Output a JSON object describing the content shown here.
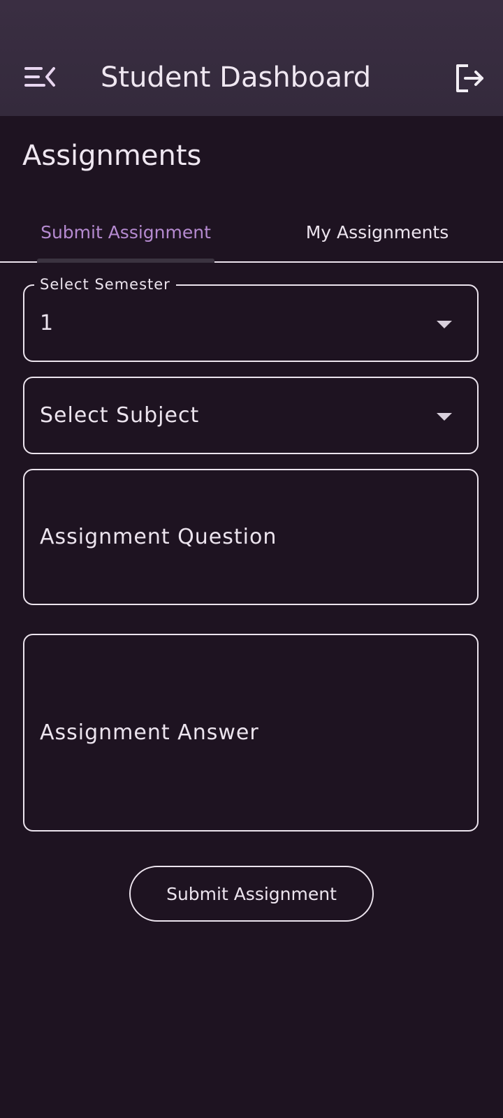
{
  "app_bar": {
    "menu_icon": "menu-open-icon",
    "title": "Student Dashboard",
    "logout_icon": "logout-icon"
  },
  "page": {
    "heading": "Assignments"
  },
  "tabs": [
    {
      "label": "Submit Assignment",
      "active": true
    },
    {
      "label": "My Assignments",
      "active": false
    }
  ],
  "form": {
    "semester": {
      "label": "Select Semester",
      "value": "1"
    },
    "subject": {
      "placeholder": "Select Subject",
      "value": ""
    },
    "question": {
      "placeholder": "Assignment Question",
      "value": ""
    },
    "answer": {
      "placeholder": "Assignment Answer",
      "value": ""
    },
    "submit_label": "Submit Assignment"
  },
  "colors": {
    "background": "#1e1321",
    "app_bar": "#382c40",
    "accent": "#b58ad0",
    "outline": "#ece4ee"
  }
}
